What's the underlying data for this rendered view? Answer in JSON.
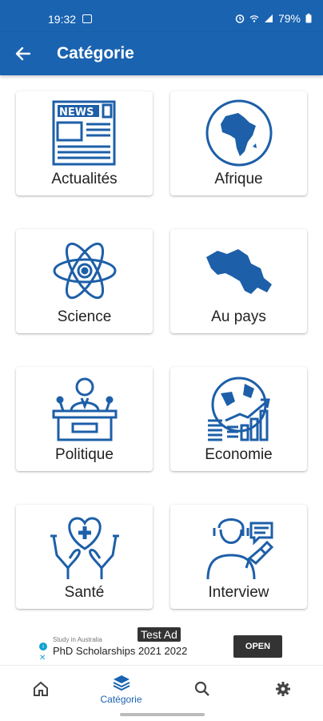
{
  "status": {
    "time": "19:32",
    "battery": "79%"
  },
  "app_bar": {
    "title": "Catégorie"
  },
  "categories": [
    {
      "label": "Actualités",
      "icon": "newspaper-icon"
    },
    {
      "label": "Afrique",
      "icon": "africa-globe-icon"
    },
    {
      "label": "Science",
      "icon": "atom-icon"
    },
    {
      "label": "Au pays",
      "icon": "country-map-icon"
    },
    {
      "label": "Politique",
      "icon": "podium-speaker-icon"
    },
    {
      "label": "Economie",
      "icon": "economy-growth-icon"
    },
    {
      "label": "Santé",
      "icon": "health-hands-icon"
    },
    {
      "label": "Interview",
      "icon": "interview-icon"
    }
  ],
  "ad": {
    "badge": "Test Ad",
    "sponsor": "Study in Australia",
    "title": "PhD Scholarships 2021 2022",
    "cta": "OPEN"
  },
  "bottom_nav": {
    "active_label": "Catégorie"
  },
  "colors": {
    "primary": "#1a63b0",
    "icon": "#1d5fa8"
  }
}
